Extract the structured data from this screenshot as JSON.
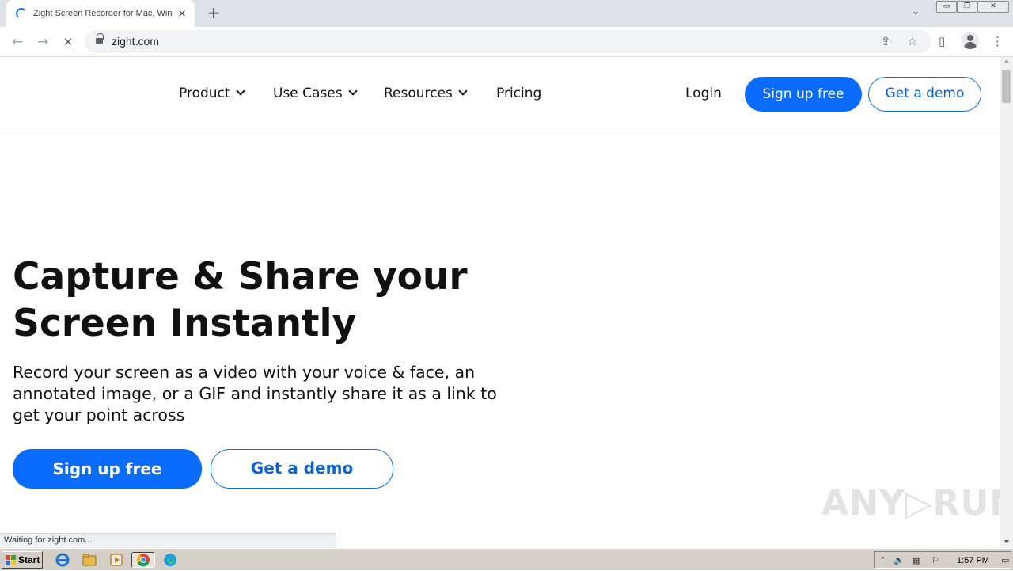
{
  "browser": {
    "tab": {
      "title": "Zight Screen Recorder for Mac, Windows",
      "close_icon": "×"
    },
    "new_tab_icon": "+",
    "tab_search_icon": "⌄",
    "window_controls": {
      "minimize": "▭",
      "restore": "❐",
      "close": "✕"
    },
    "nav": {
      "back": "←",
      "forward": "→",
      "stop": "✕"
    },
    "url": "zight.com",
    "share_icon": "⇪",
    "bookmark_icon": "☆",
    "side_panel_icon": "▯",
    "menu_icon": "⋮"
  },
  "site": {
    "nav": {
      "items": [
        {
          "label": "Product",
          "has_dropdown": true
        },
        {
          "label": "Use Cases",
          "has_dropdown": true
        },
        {
          "label": "Resources",
          "has_dropdown": true
        },
        {
          "label": "Pricing",
          "has_dropdown": false
        }
      ],
      "login": "Login",
      "signup": "Sign up free",
      "demo": "Get a demo"
    },
    "hero": {
      "title": "Capture & Share your Screen Instantly",
      "subtitle": "Record your screen as a video with your voice & face, an annotated image, or a GIF and instantly share it as a link to get your point across",
      "cta_primary": "Sign up free",
      "cta_secondary": "Get a demo"
    },
    "accent_color": "#0a6cff"
  },
  "status_text": "Waiting for zight.com...",
  "watermark": "ANY▷RUN",
  "taskbar": {
    "start_label": "Start",
    "clock": "1:57 PM",
    "apps": [
      "internet-explorer-icon",
      "file-explorer-icon",
      "media-player-icon",
      "chrome-icon",
      "edge-icon"
    ]
  }
}
